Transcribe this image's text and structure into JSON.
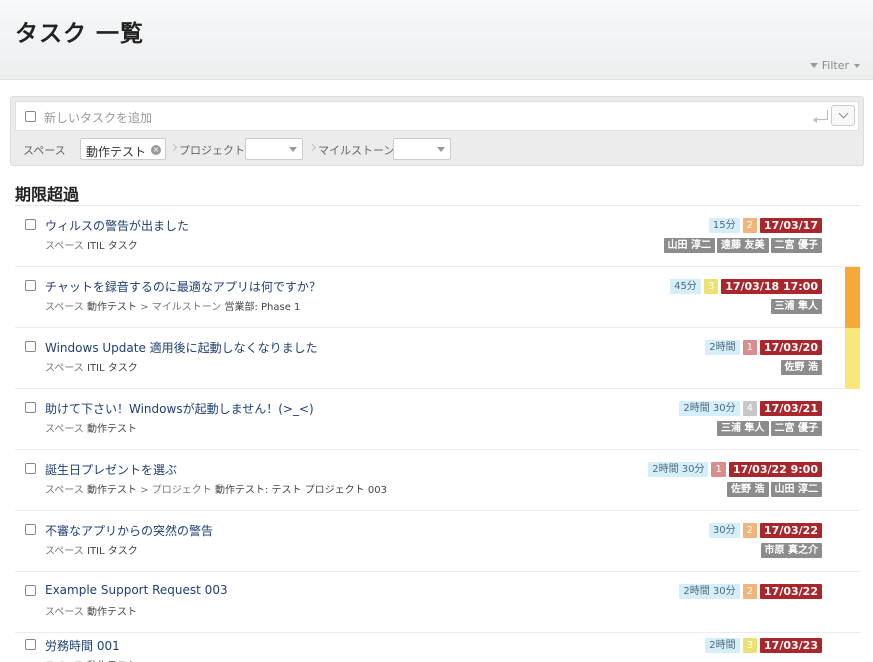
{
  "page": {
    "title": "タスク 一覧"
  },
  "filter_button": {
    "label": "Filter"
  },
  "add_task": {
    "placeholder": "新しいタスクを追加"
  },
  "filters": {
    "space_label": "スペース",
    "space_value": "動作テスト",
    "project_label": "プロジェクト",
    "milestone_label": "マイルストーン"
  },
  "colors": {
    "priority_1": "#d98e8e",
    "priority_2": "#f1b47a",
    "priority_3": "#ede171",
    "priority_4": "#c7c7c7",
    "due": "#a9262c",
    "orange_strip": "#f7a83a",
    "yellow_strip": "#fbe779"
  },
  "section": {
    "title": "期限超過"
  },
  "tasks": [
    {
      "title": "ウィルスの警告が出ました",
      "meta_prefix": "スペース",
      "meta_value": "ITIL タスク",
      "time": "15分",
      "priority": "2",
      "due": "17/03/17",
      "assignees": [
        "山田 淳二",
        "遠藤 友美",
        "二宮 優子"
      ],
      "strip": ""
    },
    {
      "title": "チャットを録音するのに最適なアプリは何ですか？",
      "meta_prefix": "スペース",
      "meta_value": "動作テスト",
      "meta_sep": ">",
      "meta_prefix2": "マイルストーン",
      "meta_value2": "営業部: Phase 1",
      "time": "45分",
      "priority": "3",
      "due": "17/03/18 17:00",
      "assignees": [
        "三浦 隼人"
      ],
      "strip": "orange"
    },
    {
      "title": "Windows Update 適用後に起動しなくなりました",
      "meta_prefix": "スペース",
      "meta_value": "ITIL タスク",
      "time": "2時間",
      "priority": "1",
      "due": "17/03/20",
      "assignees": [
        "佐野 浩"
      ],
      "strip": "yellow"
    },
    {
      "title": "助けて下さい！Windowsが起動しません！(>_<)",
      "meta_prefix": "スペース",
      "meta_value": "動作テスト",
      "time": "2時間 30分",
      "priority": "4",
      "due": "17/03/21",
      "assignees": [
        "三浦 隼人",
        "二宮 優子"
      ],
      "strip": ""
    },
    {
      "title": "誕生日プレゼントを選ぶ",
      "meta_prefix": "スペース",
      "meta_value": "動作テスト",
      "meta_sep": ">",
      "meta_prefix2": "プロジェクト",
      "meta_value2": "動作テスト: テスト プロジェクト 003",
      "time": "2時間 30分",
      "priority": "1",
      "due": "17/03/22 9:00",
      "assignees": [
        "佐野 浩",
        "山田 淳二"
      ],
      "strip": ""
    },
    {
      "title": "不審なアプリからの突然の警告",
      "meta_prefix": "スペース",
      "meta_value": "ITIL タスク",
      "time": "30分",
      "priority": "2",
      "due": "17/03/22",
      "assignees": [
        "市原 真之介"
      ],
      "strip": ""
    },
    {
      "title": "Example Support Request 003",
      "meta_prefix": "スペース",
      "meta_value": "動作テスト",
      "time": "2時間 30分",
      "priority": "2",
      "due": "17/03/22",
      "assignees": [],
      "strip": ""
    },
    {
      "title": "労務時間 001",
      "meta_prefix": "スペース",
      "meta_value": "動作テスト",
      "time": "2時間",
      "priority": "3",
      "due": "17/03/23",
      "assignees": [],
      "strip": ""
    }
  ]
}
